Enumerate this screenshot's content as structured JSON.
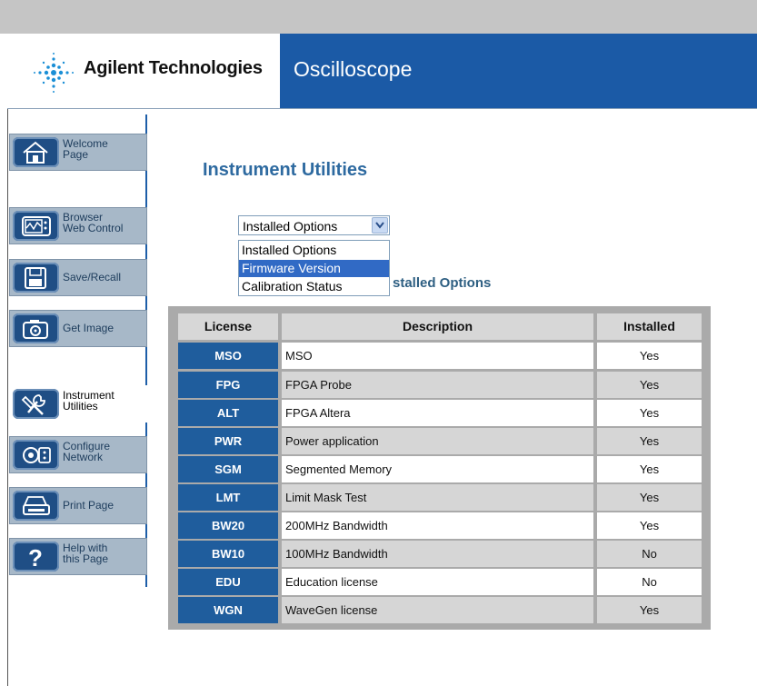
{
  "header": {
    "brand": "Agilent Technologies",
    "app_title": "Oscilloscope"
  },
  "sidebar": {
    "items": [
      {
        "line1": "Welcome",
        "line2": "Page",
        "icon": "home-icon"
      },
      {
        "line1": "Browser",
        "line2": "Web Control",
        "icon": "scope-screen-icon"
      },
      {
        "line1": "Save/Recall",
        "line2": "",
        "icon": "floppy-disk-icon"
      },
      {
        "line1": "Get Image",
        "line2": "",
        "icon": "camera-icon"
      },
      {
        "line1": "Instrument",
        "line2": "Utilities",
        "icon": "tools-icon"
      },
      {
        "line1": "Configure",
        "line2": "Network",
        "icon": "network-config-icon"
      },
      {
        "line1": "Print Page",
        "line2": "",
        "icon": "printer-icon"
      },
      {
        "line1": "Help with",
        "line2": "this Page",
        "icon": "help-icon"
      }
    ]
  },
  "main": {
    "page_title": "Instrument Utilities",
    "select": {
      "selected": "Installed Options",
      "options": [
        "Installed Options",
        "Firmware Version",
        "Calibration Status"
      ],
      "highlighted": "Firmware Version"
    },
    "section_title": "Installed Options",
    "section_title_visible": "stalled Options",
    "table": {
      "headers": [
        "License",
        "Description",
        "Installed"
      ],
      "rows": [
        {
          "license": "MSO",
          "description": "MSO",
          "installed": "Yes"
        },
        {
          "license": "FPG",
          "description": "FPGA Probe",
          "installed": "Yes"
        },
        {
          "license": "ALT",
          "description": "FPGA Altera",
          "installed": "Yes"
        },
        {
          "license": "PWR",
          "description": "Power application",
          "installed": "Yes"
        },
        {
          "license": "SGM",
          "description": "Segmented Memory",
          "installed": "Yes"
        },
        {
          "license": "LMT",
          "description": "Limit Mask Test",
          "installed": "Yes"
        },
        {
          "license": "BW20",
          "description": "200MHz Bandwidth",
          "installed": "Yes"
        },
        {
          "license": "BW10",
          "description": "100MHz Bandwidth",
          "installed": "No"
        },
        {
          "license": "EDU",
          "description": "Education license",
          "installed": "No"
        },
        {
          "license": "WGN",
          "description": "WaveGen license",
          "installed": "Yes"
        }
      ]
    }
  },
  "colors": {
    "brand_blue": "#1b5aa6",
    "nav_bg": "#a7b8c8",
    "license_cell": "#1f5d9d",
    "title_blue": "#2e6aa0",
    "selection": "#316ac5"
  }
}
